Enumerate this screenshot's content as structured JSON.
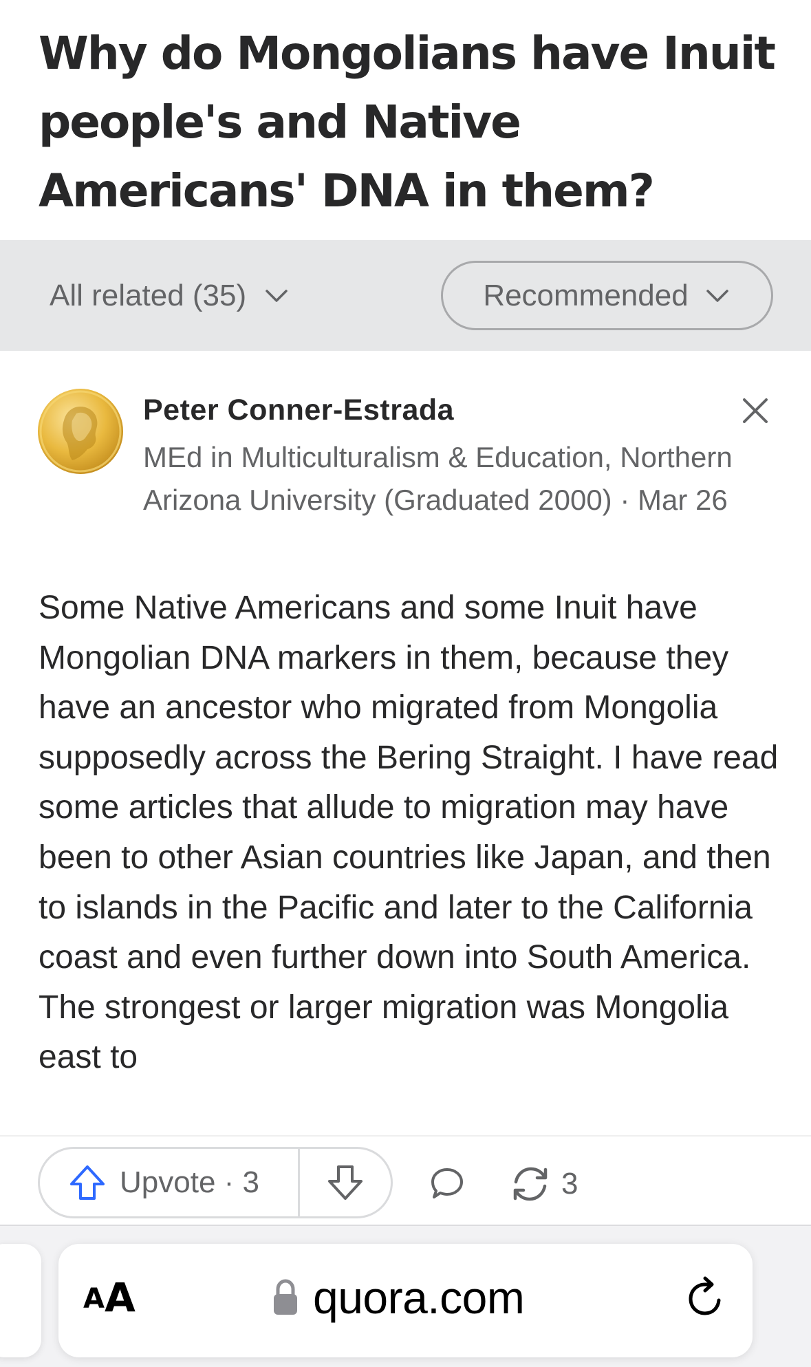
{
  "question": {
    "title": "Why do Mongolians have Inuit people's and Native Americans' DNA in them?"
  },
  "filters": {
    "all_related": "All related (35)",
    "sort": "Recommended"
  },
  "answer": {
    "author_name": "Peter Conner-Estrada",
    "credential": "MEd in Multiculturalism & Education, Northern Arizona University (Graduated 2000) · Mar 26",
    "body": "Some Native Americans and some Inuit have Mongolian DNA markers in them, because they have an ancestor who migrated from Mongolia supposedly across the Bering Straight. I have read some articles that allude to migration may have been to other Asian countries like Japan, and then to islands in the Pacific and later to the California coast and even further down into South America. The strongest or larger migration was Mongolia east to"
  },
  "actions": {
    "upvote_label": "Upvote · 3",
    "share_count": "3"
  },
  "browser": {
    "aa_small": "A",
    "aa_big": "A",
    "url": "quora.com"
  },
  "colors": {
    "upvote_blue": "#2e69ff",
    "text_primary": "#282829",
    "text_secondary": "#636466",
    "filter_bar_bg": "#e6e7e8"
  },
  "icons": {
    "filter_chevron": "chevron-down-icon",
    "close": "close-icon",
    "upvote": "arrow-up-icon",
    "downvote": "arrow-down-icon",
    "comment": "comment-bubble-icon",
    "share": "share-cycle-icon",
    "lock": "lock-icon",
    "reload": "reload-icon"
  }
}
